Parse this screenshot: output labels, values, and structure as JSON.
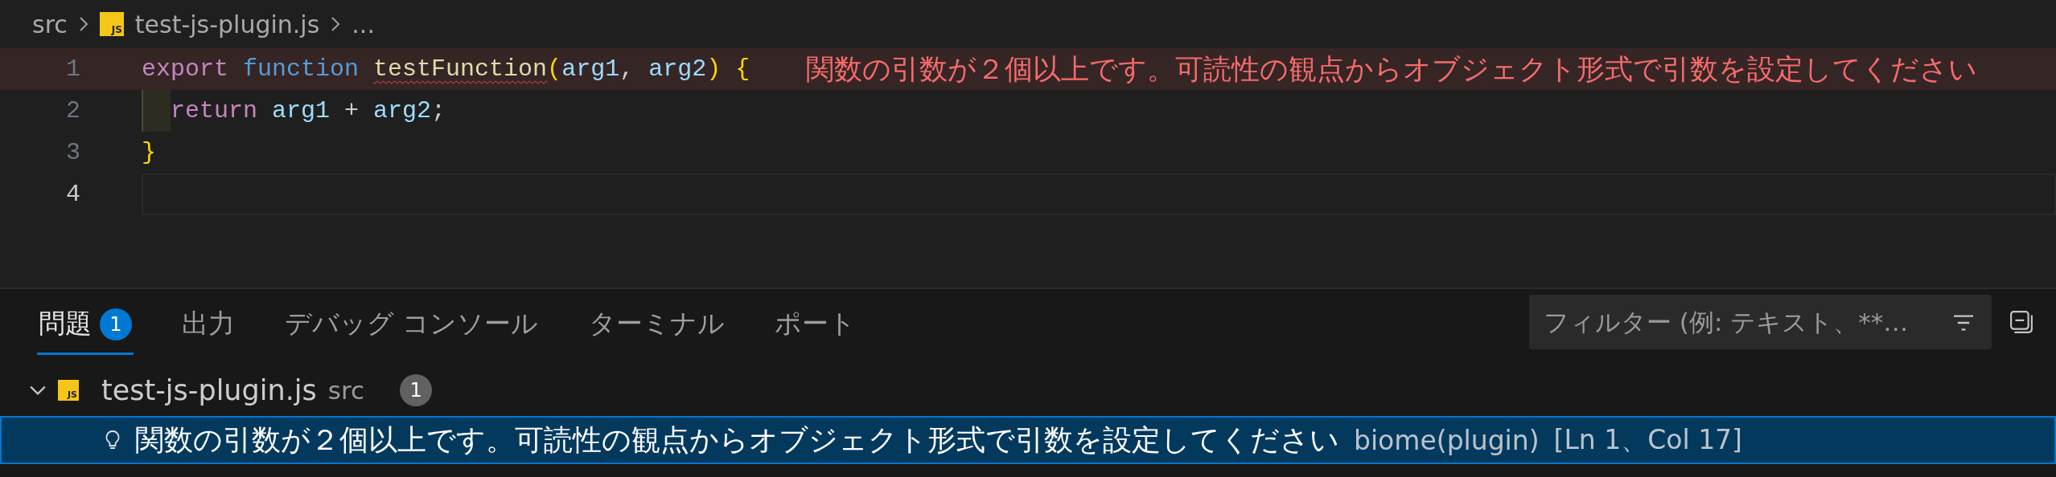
{
  "breadcrumb": [
    {
      "kind": "folder",
      "label": "src"
    },
    {
      "kind": "file",
      "label": "test-js-plugin.js",
      "icon_label": "JS"
    },
    {
      "kind": "more",
      "label": "..."
    }
  ],
  "code": {
    "lines": [
      {
        "number": "1",
        "error": true,
        "current": false,
        "tokens": [
          {
            "kind": "keyword",
            "text": "export "
          },
          {
            "kind": "storage",
            "text": "function "
          },
          {
            "kind": "function",
            "text": "testFunction",
            "squiggle": true
          },
          {
            "kind": "bracket",
            "text": "("
          },
          {
            "kind": "param",
            "text": "arg1"
          },
          {
            "kind": "plain",
            "text": ", "
          },
          {
            "kind": "param",
            "text": "arg2"
          },
          {
            "kind": "bracket",
            "text": ") "
          },
          {
            "kind": "bracket",
            "text": "{"
          }
        ],
        "inline_message": "関数の引数が２個以上です。可読性の観点からオブジェクト形式で引数を設定してください"
      },
      {
        "number": "2",
        "error": false,
        "current": false,
        "indent_guide": true,
        "tokens": [
          {
            "kind": "keyword",
            "text": "return "
          },
          {
            "kind": "param",
            "text": "arg1"
          },
          {
            "kind": "plain",
            "text": " + "
          },
          {
            "kind": "param",
            "text": "arg2"
          },
          {
            "kind": "plain",
            "text": ";"
          }
        ]
      },
      {
        "number": "3",
        "error": false,
        "current": false,
        "tokens": [
          {
            "kind": "bracket",
            "text": "}"
          }
        ]
      },
      {
        "number": "4",
        "error": false,
        "current": true
      }
    ]
  },
  "panel": {
    "tabs": [
      {
        "label": "問題",
        "badge": "1",
        "selected": true
      },
      {
        "label": "出力",
        "selected": false
      },
      {
        "label": "デバッグ コンソール",
        "selected": false
      },
      {
        "label": "ターミナル",
        "selected": false
      },
      {
        "label": "ポート",
        "selected": false
      }
    ],
    "filter": {
      "placeholder": "フィルター (例: テキスト、**…"
    },
    "problems": [
      {
        "file": "test-js-plugin.js",
        "icon_label": "JS",
        "folder": "src",
        "count": "1",
        "expanded": true,
        "items": [
          {
            "kind": "info",
            "message": "関数の引数が２個以上です。可読性の観点からオブジェクト形式で引数を設定してください",
            "source": "biome(plugin)",
            "location": "[Ln 1、Col 17]",
            "selected": true
          }
        ]
      }
    ]
  }
}
